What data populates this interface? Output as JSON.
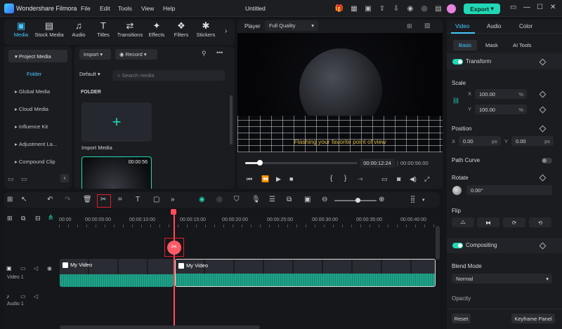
{
  "app": {
    "name": "Wondershare Filmora",
    "project": "Untitled",
    "export_label": "Export",
    "accent": "#20d8b5"
  },
  "menu": [
    "File",
    "Edit",
    "Tools",
    "View",
    "Help"
  ],
  "media_tabs": [
    {
      "label": "Media",
      "icon": "media-icon",
      "active": true
    },
    {
      "label": "Stock Media",
      "icon": "stock-media-icon"
    },
    {
      "label": "Audio",
      "icon": "audio-icon"
    },
    {
      "label": "Titles",
      "icon": "titles-icon"
    },
    {
      "label": "Transitions",
      "icon": "transitions-icon"
    },
    {
      "label": "Effects",
      "icon": "effects-icon"
    },
    {
      "label": "Filters",
      "icon": "filters-icon"
    },
    {
      "label": "Stickers",
      "icon": "stickers-icon"
    }
  ],
  "sidebar": {
    "items": [
      "Project Media",
      "Folder",
      "Global Media",
      "Cloud Media",
      "Influence Kit",
      "Adjustment La...",
      "Compound Clip"
    ]
  },
  "media": {
    "import_label": "Import",
    "record_label": "Record",
    "sort_label": "Default",
    "search_placeholder": "Search media",
    "folder_heading": "FOLDER",
    "import_media_label": "Import Media",
    "clip_duration": "00:00:56"
  },
  "player": {
    "label": "Player",
    "quality": "Full Quality",
    "caption": "Flashing your favorite point of view",
    "current_time": "00:00:12:24",
    "total_time": "00:00:56:00",
    "progress": 0.13
  },
  "inspector": {
    "tabs": [
      "Video",
      "Audio",
      "Color"
    ],
    "subtabs": [
      "Basic",
      "Mask",
      "AI Tools"
    ],
    "transform": "Transform",
    "scale": "Scale",
    "x_label": "X",
    "y_label": "Y",
    "scale_x": "100.00",
    "scale_y": "100.00",
    "percent": "%",
    "position": "Position",
    "pos_x": "0.00",
    "pos_y": "0.00",
    "px": "px",
    "path_curve": "Path Curve",
    "rotate": "Rotate",
    "rotate_value": "0.00°",
    "flip": "Flip",
    "compositing": "Compositing",
    "blend_mode": "Blend Mode",
    "blend_value": "Normal",
    "opacity": "Opacity",
    "reset": "Reset",
    "keyframe_panel": "Keyframe Panel"
  },
  "timeline": {
    "ticks": [
      "00:00",
      "00:00:05:00",
      "00:00:10:00",
      "00:00:15:00",
      "00:00:20:00",
      "00:00:25:00",
      "00:00:30:00",
      "00:00:35:00",
      "00:00:40:00"
    ],
    "tracks": {
      "video": "Video 1",
      "audio": "Audio 1"
    },
    "clips": [
      {
        "name": "My Video"
      },
      {
        "name": "My Video"
      }
    ]
  }
}
